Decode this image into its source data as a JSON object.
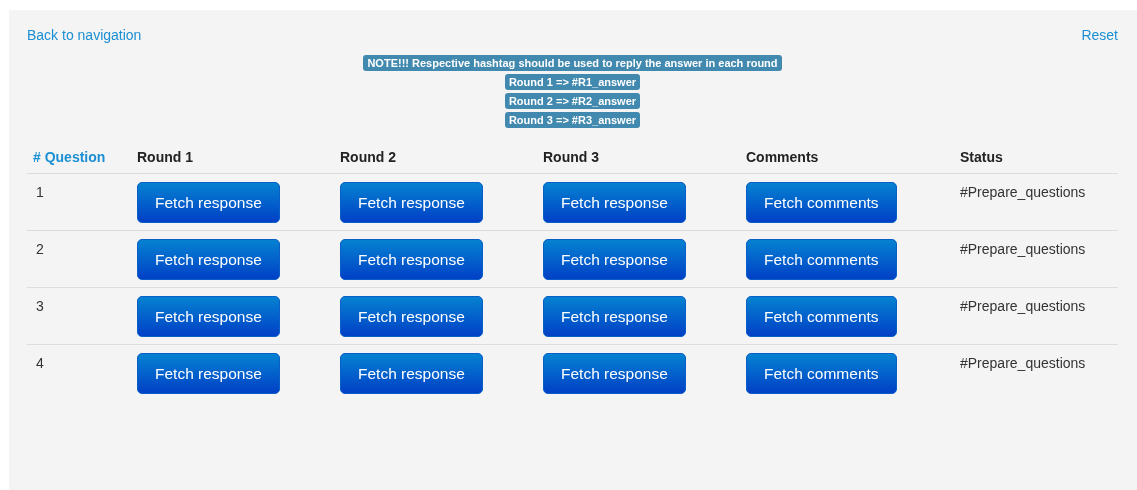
{
  "links": {
    "back": "Back to navigation",
    "reset": "Reset"
  },
  "notes": [
    "NOTE!!! Respective hashtag should be used to reply the answer in each round",
    "Round 1 => #R1_answer",
    "Round 2 => #R2_answer",
    "Round 3 => #R3_answer"
  ],
  "table": {
    "columns": [
      {
        "label": "# Question",
        "kind": "link"
      },
      {
        "label": "Round 1",
        "kind": "text"
      },
      {
        "label": "Round 2",
        "kind": "text"
      },
      {
        "label": "Round 3",
        "kind": "text"
      },
      {
        "label": "Comments",
        "kind": "text"
      },
      {
        "label": "Status",
        "kind": "text"
      }
    ],
    "rows": [
      {
        "question": "1",
        "buttons": [
          "Fetch response",
          "Fetch response",
          "Fetch response",
          "Fetch comments"
        ],
        "status": "#Prepare_questions"
      },
      {
        "question": "2",
        "buttons": [
          "Fetch response",
          "Fetch response",
          "Fetch response",
          "Fetch comments"
        ],
        "status": "#Prepare_questions"
      },
      {
        "question": "3",
        "buttons": [
          "Fetch response",
          "Fetch response",
          "Fetch response",
          "Fetch comments"
        ],
        "status": "#Prepare_questions"
      },
      {
        "question": "4",
        "buttons": [
          "Fetch response",
          "Fetch response",
          "Fetch response",
          "Fetch comments"
        ],
        "status": "#Prepare_questions"
      }
    ]
  }
}
